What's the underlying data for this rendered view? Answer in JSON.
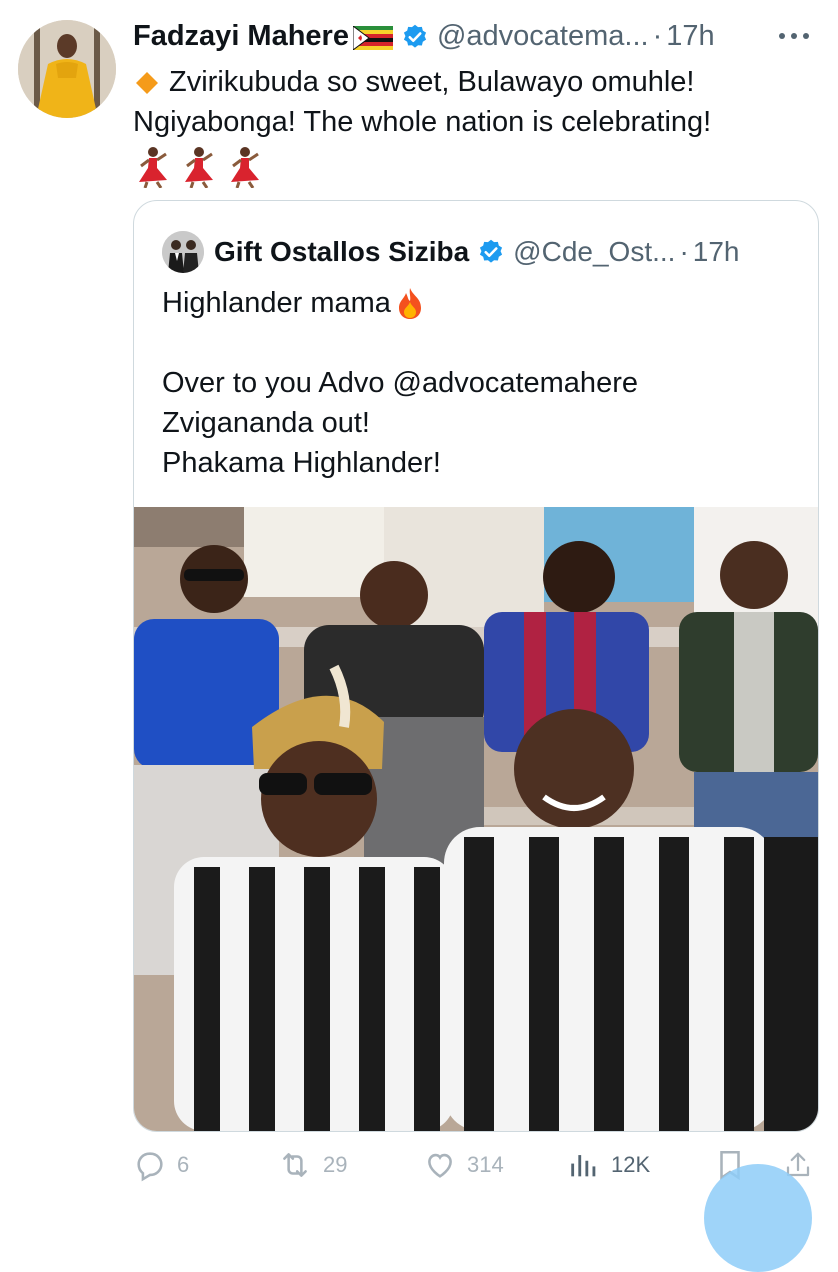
{
  "tweet": {
    "author_name": "Fadzayi Mahere",
    "handle": "@advocatema...",
    "time": "17h",
    "text_line1": "Zvirikubuda so sweet, Bulawayo omuhle!",
    "text_line2": "Ngiyabonga! The whole nation is celebrating!",
    "emoji_icons": [
      "diamond-icon",
      "dancer-icon",
      "flag-icon",
      "verified-icon"
    ]
  },
  "quote": {
    "author_name": "Gift Ostallos Siziba",
    "handle": "@Cde_Ost...",
    "time": "17h",
    "line1": "Highlander mama",
    "line2": "Over to you Advo @advocatemahere",
    "line3": "Zvigananda out!",
    "line4": "Phakama Highlander!"
  },
  "actions": {
    "replies": "6",
    "reposts": "29",
    "likes": "314",
    "views": "12K"
  },
  "colors": {
    "accent": "#1d9bf0",
    "muted": "#536471",
    "action_gray": "#a9b3bb"
  }
}
